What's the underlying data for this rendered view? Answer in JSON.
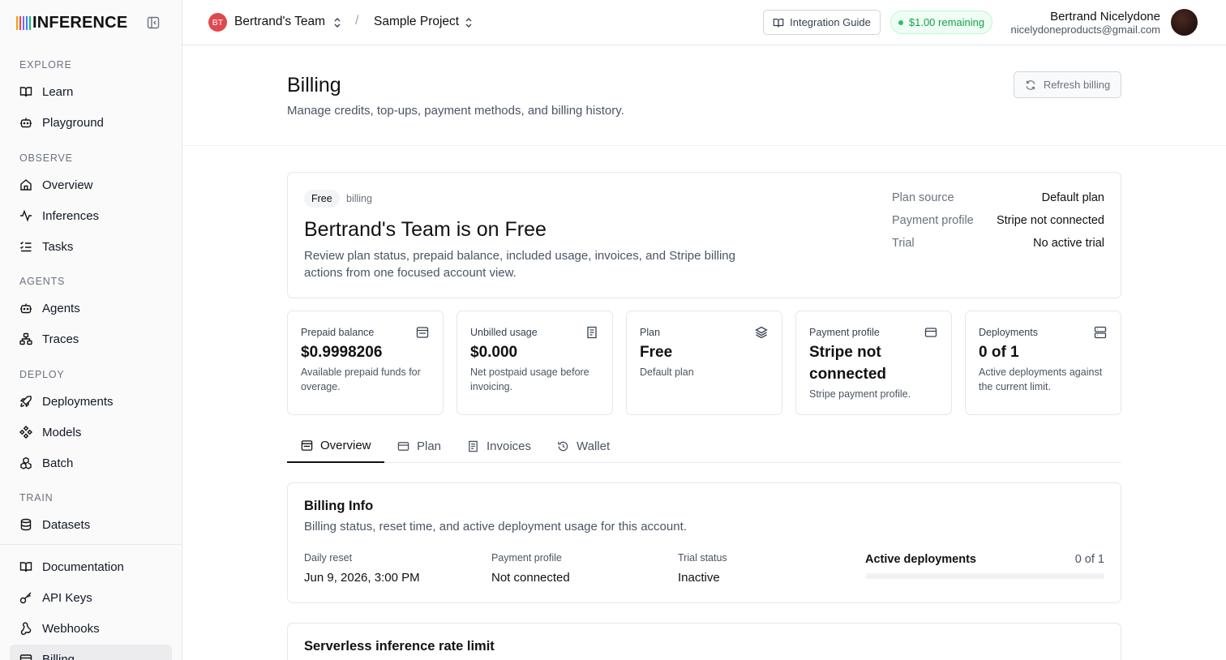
{
  "brand": {
    "name": "INFERENCE",
    "bar_colors": [
      "#f59e0b",
      "#ef4444",
      "#8b5cf6",
      "#3b82f6",
      "#10b981"
    ]
  },
  "sidebar": {
    "sections": {
      "explore": "EXPLORE",
      "observe": "OBSERVE",
      "agents": "AGENTS",
      "deploy": "DEPLOY",
      "train": "TRAIN"
    },
    "items": {
      "learn": "Learn",
      "playground": "Playground",
      "overview": "Overview",
      "inferences": "Inferences",
      "tasks": "Tasks",
      "agents": "Agents",
      "traces": "Traces",
      "deployments": "Deployments",
      "models": "Models",
      "batch": "Batch",
      "datasets": "Datasets",
      "documentation": "Documentation",
      "api_keys": "API Keys",
      "webhooks": "Webhooks",
      "billing": "Billing"
    },
    "active_item": "billing"
  },
  "topbar": {
    "team_initials": "BT",
    "team_name": "Bertrand's Team",
    "separator": "/",
    "project_name": "Sample Project",
    "guide_label": "Integration Guide",
    "balance_label": "$1.00 remaining",
    "user_name": "Bertrand Nicelydone",
    "user_email": "nicelydoneproducts@gmail.com"
  },
  "page": {
    "title": "Billing",
    "subtitle": "Manage credits, top-ups, payment methods, and billing history.",
    "refresh_label": "Refresh billing"
  },
  "summary": {
    "plan_chip": "Free",
    "chip_suffix": "billing",
    "title": "Bertrand's Team is on Free",
    "description": "Review plan status, prepaid balance, included usage, invoices, and Stripe billing actions from one focused account view.",
    "details": [
      {
        "label": "Plan source",
        "value": "Default plan"
      },
      {
        "label": "Payment profile",
        "value": "Stripe not connected"
      },
      {
        "label": "Trial",
        "value": "No active trial"
      }
    ]
  },
  "stats": [
    {
      "label": "Prepaid balance",
      "value": "$0.9998206",
      "desc": "Available prepaid funds for overage.",
      "icon": "wallet-icon"
    },
    {
      "label": "Unbilled usage",
      "value": "$0.000",
      "desc": "Net postpaid usage before invoicing.",
      "icon": "receipt-icon"
    },
    {
      "label": "Plan",
      "value": "Free",
      "desc": "Default plan",
      "icon": "layers-icon"
    },
    {
      "label": "Payment profile",
      "value": "Stripe not connected",
      "desc": "Stripe payment profile.",
      "icon": "credit-card-icon"
    },
    {
      "label": "Deployments",
      "value": "0 of 1",
      "desc": "Active deployments against the current limit.",
      "icon": "server-icon"
    }
  ],
  "tabs": [
    {
      "label": "Overview",
      "active": true
    },
    {
      "label": "Plan",
      "active": false
    },
    {
      "label": "Invoices",
      "active": false
    },
    {
      "label": "Wallet",
      "active": false
    }
  ],
  "billing_info": {
    "title": "Billing Info",
    "description": "Billing status, reset time, and active deployment usage for this account.",
    "fields": [
      {
        "label": "Daily reset",
        "value": "Jun 9, 2026, 3:00 PM"
      },
      {
        "label": "Payment profile",
        "value": "Not connected"
      },
      {
        "label": "Trial status",
        "value": "Inactive"
      }
    ],
    "active_label": "Active deployments",
    "active_value": "0 of 1",
    "active_fraction": 0
  },
  "rate_limit": {
    "title": "Serverless inference rate limit"
  }
}
